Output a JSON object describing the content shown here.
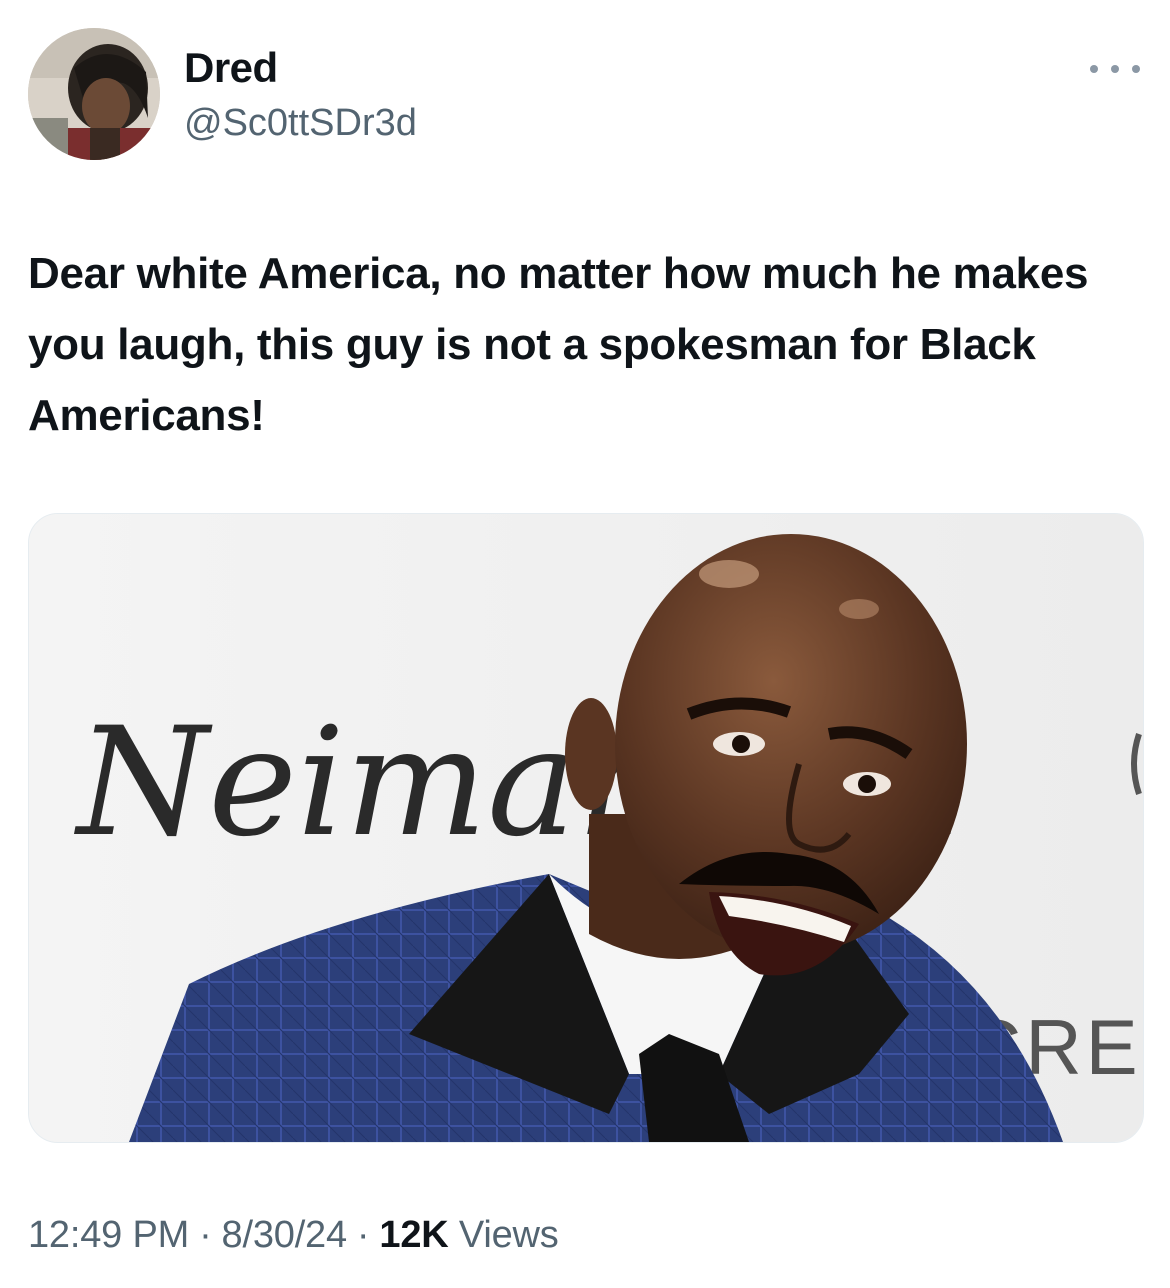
{
  "author": {
    "display_name": "Dred",
    "handle": "@Sc0ttSDr3d",
    "avatar_icon": "profile-photo"
  },
  "menu": {
    "icon": "more-horizontal-icon"
  },
  "tweet": {
    "text": "Dear white America, no matter how much he makes you laugh, this guy is not a spokesman for Black Americans!"
  },
  "media": {
    "backdrop_text_1": "Neiman Ma",
    "backdrop_text_2": "SCRE"
  },
  "meta": {
    "time": "12:49 PM",
    "separator": "·",
    "date": "8/30/24",
    "views_count": "12K",
    "views_label": "Views"
  },
  "colors": {
    "text_primary": "#0f1419",
    "text_secondary": "#536471",
    "suit_blue": "#2c3f7a"
  }
}
